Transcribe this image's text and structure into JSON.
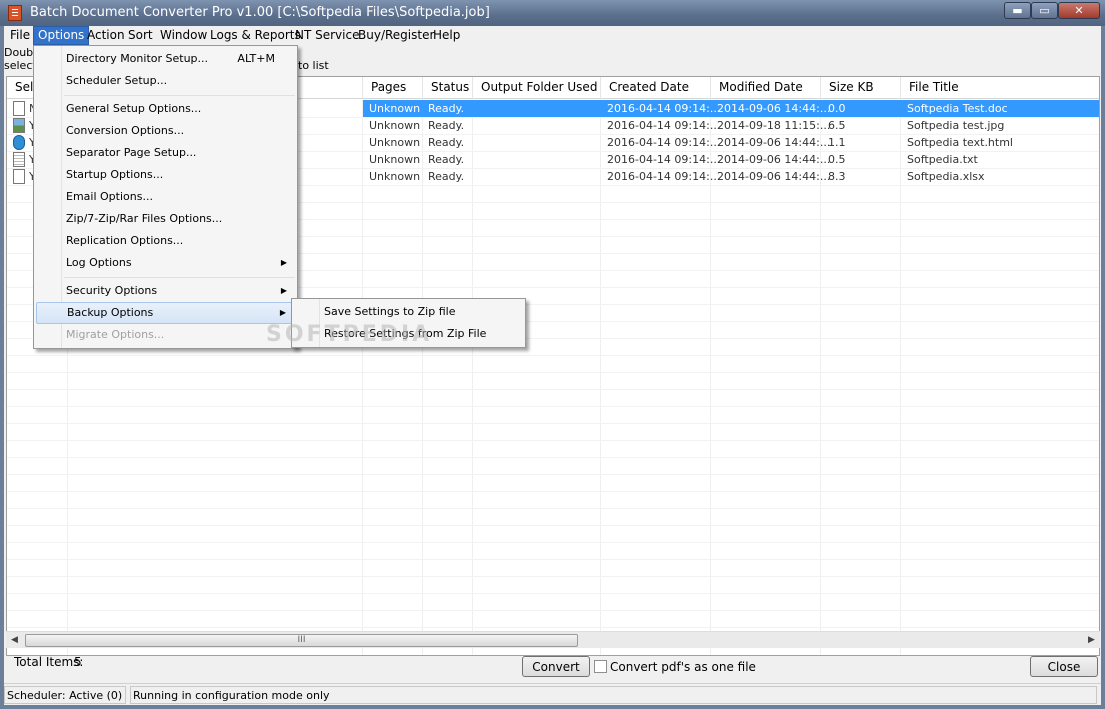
{
  "window": {
    "title": "Batch Document Converter Pro v1.00  [C:\\Softpedia Files\\Softpedia.job]",
    "minimize_glyph": "▬",
    "maximize_glyph": "▭",
    "close_glyph": "✕"
  },
  "menubar": {
    "items": [
      "File",
      "Options",
      "Action",
      "Sort",
      "Window",
      "Logs & Reports",
      "NT Service",
      "Buy/Register",
      "Help"
    ]
  },
  "hints": {
    "line1": "Doubl",
    "line2": "select",
    "line3": "to list"
  },
  "table": {
    "columns": [
      "Sele",
      "Pages",
      "Status",
      "Output Folder Used",
      "Created Date",
      "Modified Date",
      "Size KB",
      "File Title"
    ],
    "rows": [
      {
        "icon": "doc-file-icon",
        "sel": "N",
        "pages": "Unknown",
        "status": "Ready.",
        "output": "",
        "created": "2016-04-14 09:14:...",
        "modified": "2014-09-06 14:44:...",
        "size": "0.0",
        "title": "Softpedia Test.doc",
        "selected": true
      },
      {
        "icon": "image-file-icon",
        "sel": "Y",
        "pages": "Unknown",
        "status": "Ready.",
        "output": "",
        "created": "2016-04-14 09:14:...",
        "modified": "2014-09-18 11:15:...",
        "size": "6.5",
        "title": "Softpedia test.jpg",
        "selected": false
      },
      {
        "icon": "html-file-icon",
        "sel": "Y",
        "pages": "Unknown",
        "status": "Ready.",
        "output": "",
        "created": "2016-04-14 09:14:...",
        "modified": "2014-09-06 14:44:...",
        "size": "1.1",
        "title": "Softpedia text.html",
        "selected": false
      },
      {
        "icon": "text-file-icon",
        "sel": "Y",
        "pages": "Unknown",
        "status": "Ready.",
        "output": "",
        "created": "2016-04-14 09:14:...",
        "modified": "2014-09-06 14:44:...",
        "size": "0.5",
        "title": "Softpedia.txt",
        "selected": false
      },
      {
        "icon": "blank-file-icon",
        "sel": "Y",
        "pages": "Unknown",
        "status": "Ready.",
        "output": "",
        "created": "2016-04-14 09:14:...",
        "modified": "2014-09-06 14:44:...",
        "size": "8.3",
        "title": "Softpedia.xlsx",
        "selected": false
      }
    ]
  },
  "scrollbar": {
    "left_arrow": "◀",
    "right_arrow": "▶",
    "grip": "III"
  },
  "bottom": {
    "total_items_label": "Total Items:",
    "total_items_value": "5",
    "convert_button": "Convert",
    "convert_pdf_one_file": "Convert pdf's as one file",
    "close_button": "Close"
  },
  "statusbar": {
    "scheduler": "Scheduler: Active (0)",
    "mode": "Running in configuration mode only"
  },
  "options_menu": {
    "items": [
      {
        "label": "Directory Monitor Setup...",
        "shortcut": "ALT+M"
      },
      {
        "label": "Scheduler Setup..."
      },
      {
        "label": "General Setup Options..."
      },
      {
        "label": "Conversion Options..."
      },
      {
        "label": "Separator Page Setup..."
      },
      {
        "label": "Startup Options..."
      },
      {
        "label": "Email Options..."
      },
      {
        "label": "Zip/7-Zip/Rar Files Options..."
      },
      {
        "label": "Replication Options..."
      },
      {
        "label": "Log Options"
      },
      {
        "label": "Security Options"
      },
      {
        "label": "Backup Options"
      },
      {
        "label": "Migrate Options..."
      }
    ],
    "submenu_arrow": "▶"
  },
  "backup_submenu": {
    "items": [
      "Save Settings to Zip file",
      "Restore Settings from Zip File"
    ]
  },
  "watermark": "SOFTPEDIA"
}
